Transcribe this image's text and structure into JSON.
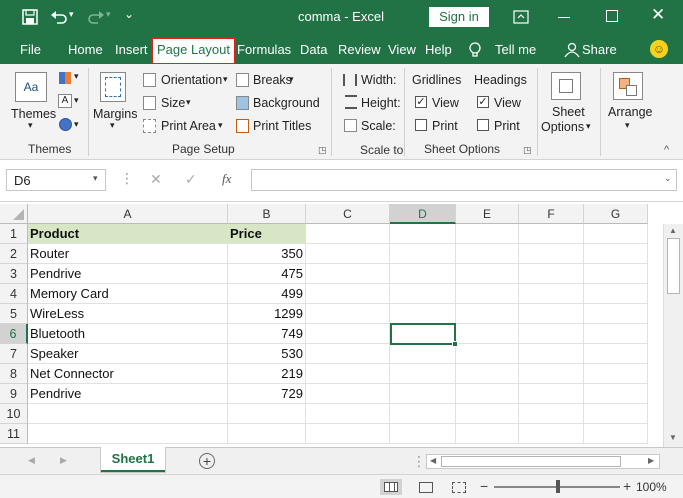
{
  "title_bar": {
    "doc_title": "comma  -  Excel",
    "sign_in": "Sign in"
  },
  "tabs": [
    "File",
    "Home",
    "Insert",
    "Page Layout",
    "Formulas",
    "Data",
    "Review",
    "View",
    "Help"
  ],
  "tell_me": "Tell me",
  "share": "Share",
  "ribbon": {
    "themes": {
      "label": "Themes",
      "group": "Themes"
    },
    "page_setup": {
      "margins": "Margins",
      "orientation": "Orientation",
      "size": "Size",
      "print_area": "Print Area",
      "breaks": "Breaks",
      "background": "Background",
      "print_titles": "Print Titles",
      "group": "Page Setup"
    },
    "scale": {
      "width": "Width:",
      "height": "Height:",
      "scale": "Scale:",
      "group": "Scale to"
    },
    "sheet_options": {
      "gridlines": "Gridlines",
      "headings": "Headings",
      "view": "View",
      "print": "Print",
      "gridlines_view_checked": true,
      "gridlines_print_checked": false,
      "headings_view_checked": true,
      "headings_print_checked": false,
      "sheet_options_btn_1": "Sheet",
      "sheet_options_btn_2": "Options",
      "group": "Sheet Options"
    },
    "arrange": {
      "label": "Arrange"
    }
  },
  "formula_bar": {
    "name_box": "D6",
    "fx": "fx",
    "value": ""
  },
  "columns": [
    "A",
    "B",
    "C",
    "D",
    "E",
    "F",
    "G"
  ],
  "rows": [
    {
      "n": "1",
      "a": "Product",
      "b": "Price"
    },
    {
      "n": "2",
      "a": "Router",
      "b": "350"
    },
    {
      "n": "3",
      "a": "Pendrive",
      "b": "475"
    },
    {
      "n": "4",
      "a": "Memory Card",
      "b": "499"
    },
    {
      "n": "5",
      "a": "WireLess",
      "b": "1299"
    },
    {
      "n": "6",
      "a": "Bluetooth",
      "b": "749"
    },
    {
      "n": "7",
      "a": "Speaker",
      "b": "530"
    },
    {
      "n": "8",
      "a": "Net Connector",
      "b": "219"
    },
    {
      "n": "9",
      "a": "Pendrive",
      "b": "729"
    },
    {
      "n": "10",
      "a": "",
      "b": ""
    },
    {
      "n": "11",
      "a": "",
      "b": ""
    }
  ],
  "selected_cell": "D6",
  "sheet_tab": "Sheet1",
  "zoom": "100%",
  "colors": {
    "brand": "#217346",
    "header_fill": "#d7e6c4",
    "highlight": "#e0201b"
  }
}
